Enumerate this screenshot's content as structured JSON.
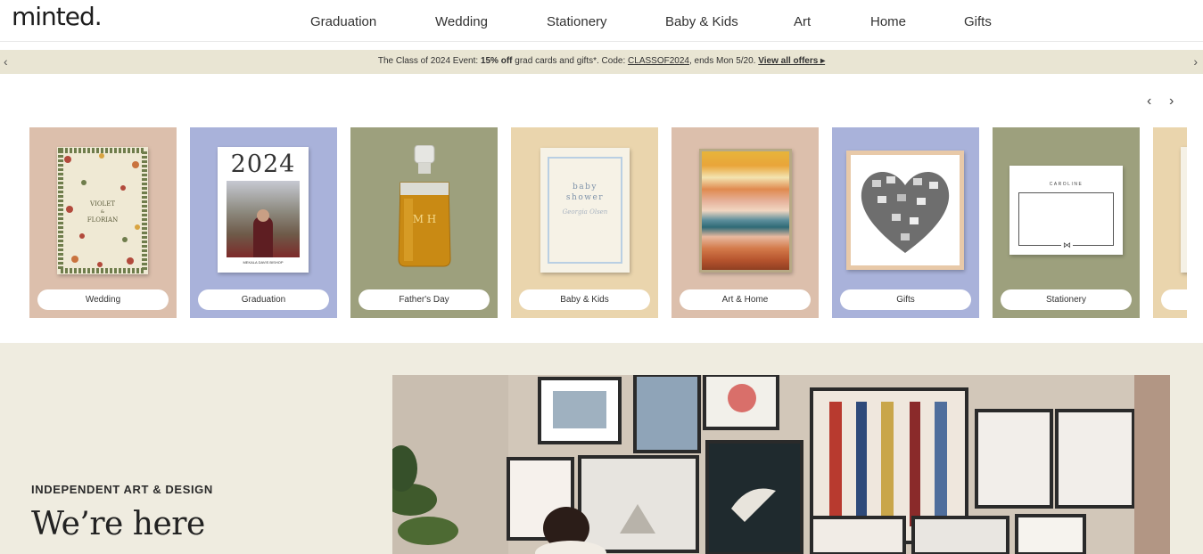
{
  "header": {
    "logo": "minted.",
    "nav": [
      "Graduation",
      "Wedding",
      "Stationery",
      "Baby & Kids",
      "Art",
      "Home",
      "Gifts"
    ]
  },
  "promo": {
    "prefix": "The Class of 2024 Event: ",
    "bold": "15% off",
    "middle": " grad cards and gifts*. Code: ",
    "code": "CLASSOF2024",
    "suffix": ", ends Mon 5/20. ",
    "link": "View all offers ▸",
    "left_icon": "chevron-left-icon",
    "right_icon": "chevron-right-icon"
  },
  "carousel": {
    "prev_icon": "chevron-left-icon",
    "next_icon": "chevron-right-icon",
    "tiles": [
      {
        "label": "Wedding",
        "bg": "#dcbfac"
      },
      {
        "label": "Graduation",
        "bg": "#a9b2da"
      },
      {
        "label": "Father's Day",
        "bg": "#9da07d"
      },
      {
        "label": "Baby & Kids",
        "bg": "#ead5ad"
      },
      {
        "label": "Art & Home",
        "bg": "#dcbfac"
      },
      {
        "label": "Gifts",
        "bg": "#a9b2da"
      },
      {
        "label": "Stationery",
        "bg": "#9da07d"
      },
      {
        "label": "",
        "bg": "#ead5ad"
      }
    ],
    "wedding_card": {
      "line1": "VIOLET",
      "line2": "FLORIAN"
    },
    "grad_card": {
      "year": "2024",
      "caption": "MEKALA DAVIS BISHOP"
    },
    "fathers_day": {
      "monogram": "M H"
    },
    "baby_card": {
      "line1": "baby",
      "line2": "shower",
      "name": "Georgia Olsen"
    },
    "stationery_card": {
      "name": "CAROLINE"
    }
  },
  "hero": {
    "eyebrow": "INDEPENDENT ART & DESIGN",
    "title": "We’re here"
  }
}
